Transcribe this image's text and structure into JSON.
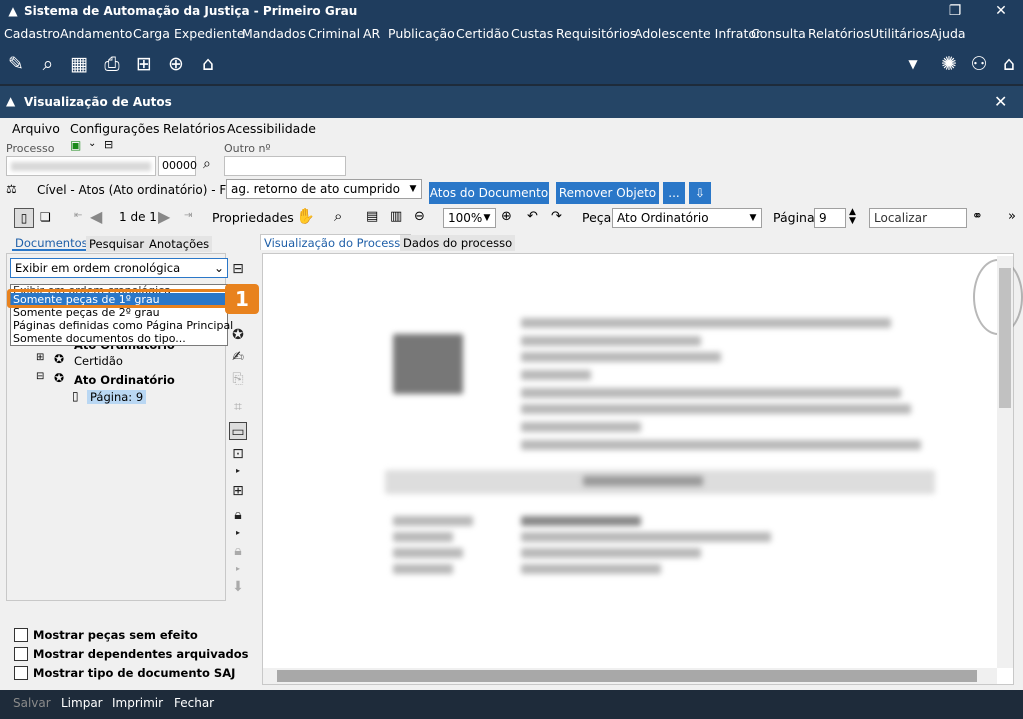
{
  "window": {
    "title": "Sistema de Automação da Justiça - Primeiro Grau"
  },
  "menu": [
    "Cadastro",
    "Andamento",
    "Carga",
    "Expediente",
    "Mandados",
    "Criminal",
    "AR",
    "Publicação",
    "Certidão",
    "Custas",
    "Requisitórios",
    "Adolescente Infrator",
    "Consulta",
    "Relatórios",
    "Utilitários",
    "Ajuda"
  ],
  "panel": {
    "title": "Visualização de Autos"
  },
  "submenu": [
    "Arquivo",
    "Configurações",
    "Relatórios",
    "Acessibilidade"
  ],
  "form": {
    "processo_label": "Processo",
    "outro_label": "Outro nº",
    "processo_suffix": "00000",
    "class_text": "Cível - Atos (Ato ordinatório) - Fila:",
    "fila_value": "ag. retorno de ato cumprido",
    "atos_btn": "Atos do Documento",
    "remover_btn": "Remover Objeto",
    "more_btn": "..."
  },
  "viewer_toolbar": {
    "page_of": "1 de 1",
    "propriedades": "Propriedades",
    "zoom": "100%",
    "peca_label": "Peça",
    "peca_value": "Ato Ordinatório",
    "pagina_label": "Página",
    "pagina_value": "9",
    "localizar_placeholder": "Localizar"
  },
  "left_tabs": [
    "Documentos",
    "Pesquisar",
    "Anotações"
  ],
  "order_select": "Exibir em ordem cronológica",
  "dropdown_options": [
    "Exibir em ordem cronológica",
    "Somente peças de 1º grau",
    "Somente peças de 2º grau",
    "Páginas definidas como Página Principal",
    "Somente documentos do tipo..."
  ],
  "step_badge": "1",
  "tree": {
    "partial": "Ato Ordinatório",
    "certidao": "Certidão",
    "ato": "Ato Ordinatório",
    "pagina": "Página: 9"
  },
  "checkboxes": [
    "Mostrar peças sem efeito",
    "Mostrar dependentes arquivados",
    "Mostrar tipo de documento SAJ"
  ],
  "right_tabs": [
    "Visualização do Processo",
    "Dados do processo"
  ],
  "bottom": [
    "Salvar",
    "Limpar",
    "Imprimir",
    "Fechar"
  ],
  "colors": {
    "titlebar": "#1f3d5e",
    "accent": "#2a77c8",
    "highlight": "#e8821e"
  }
}
